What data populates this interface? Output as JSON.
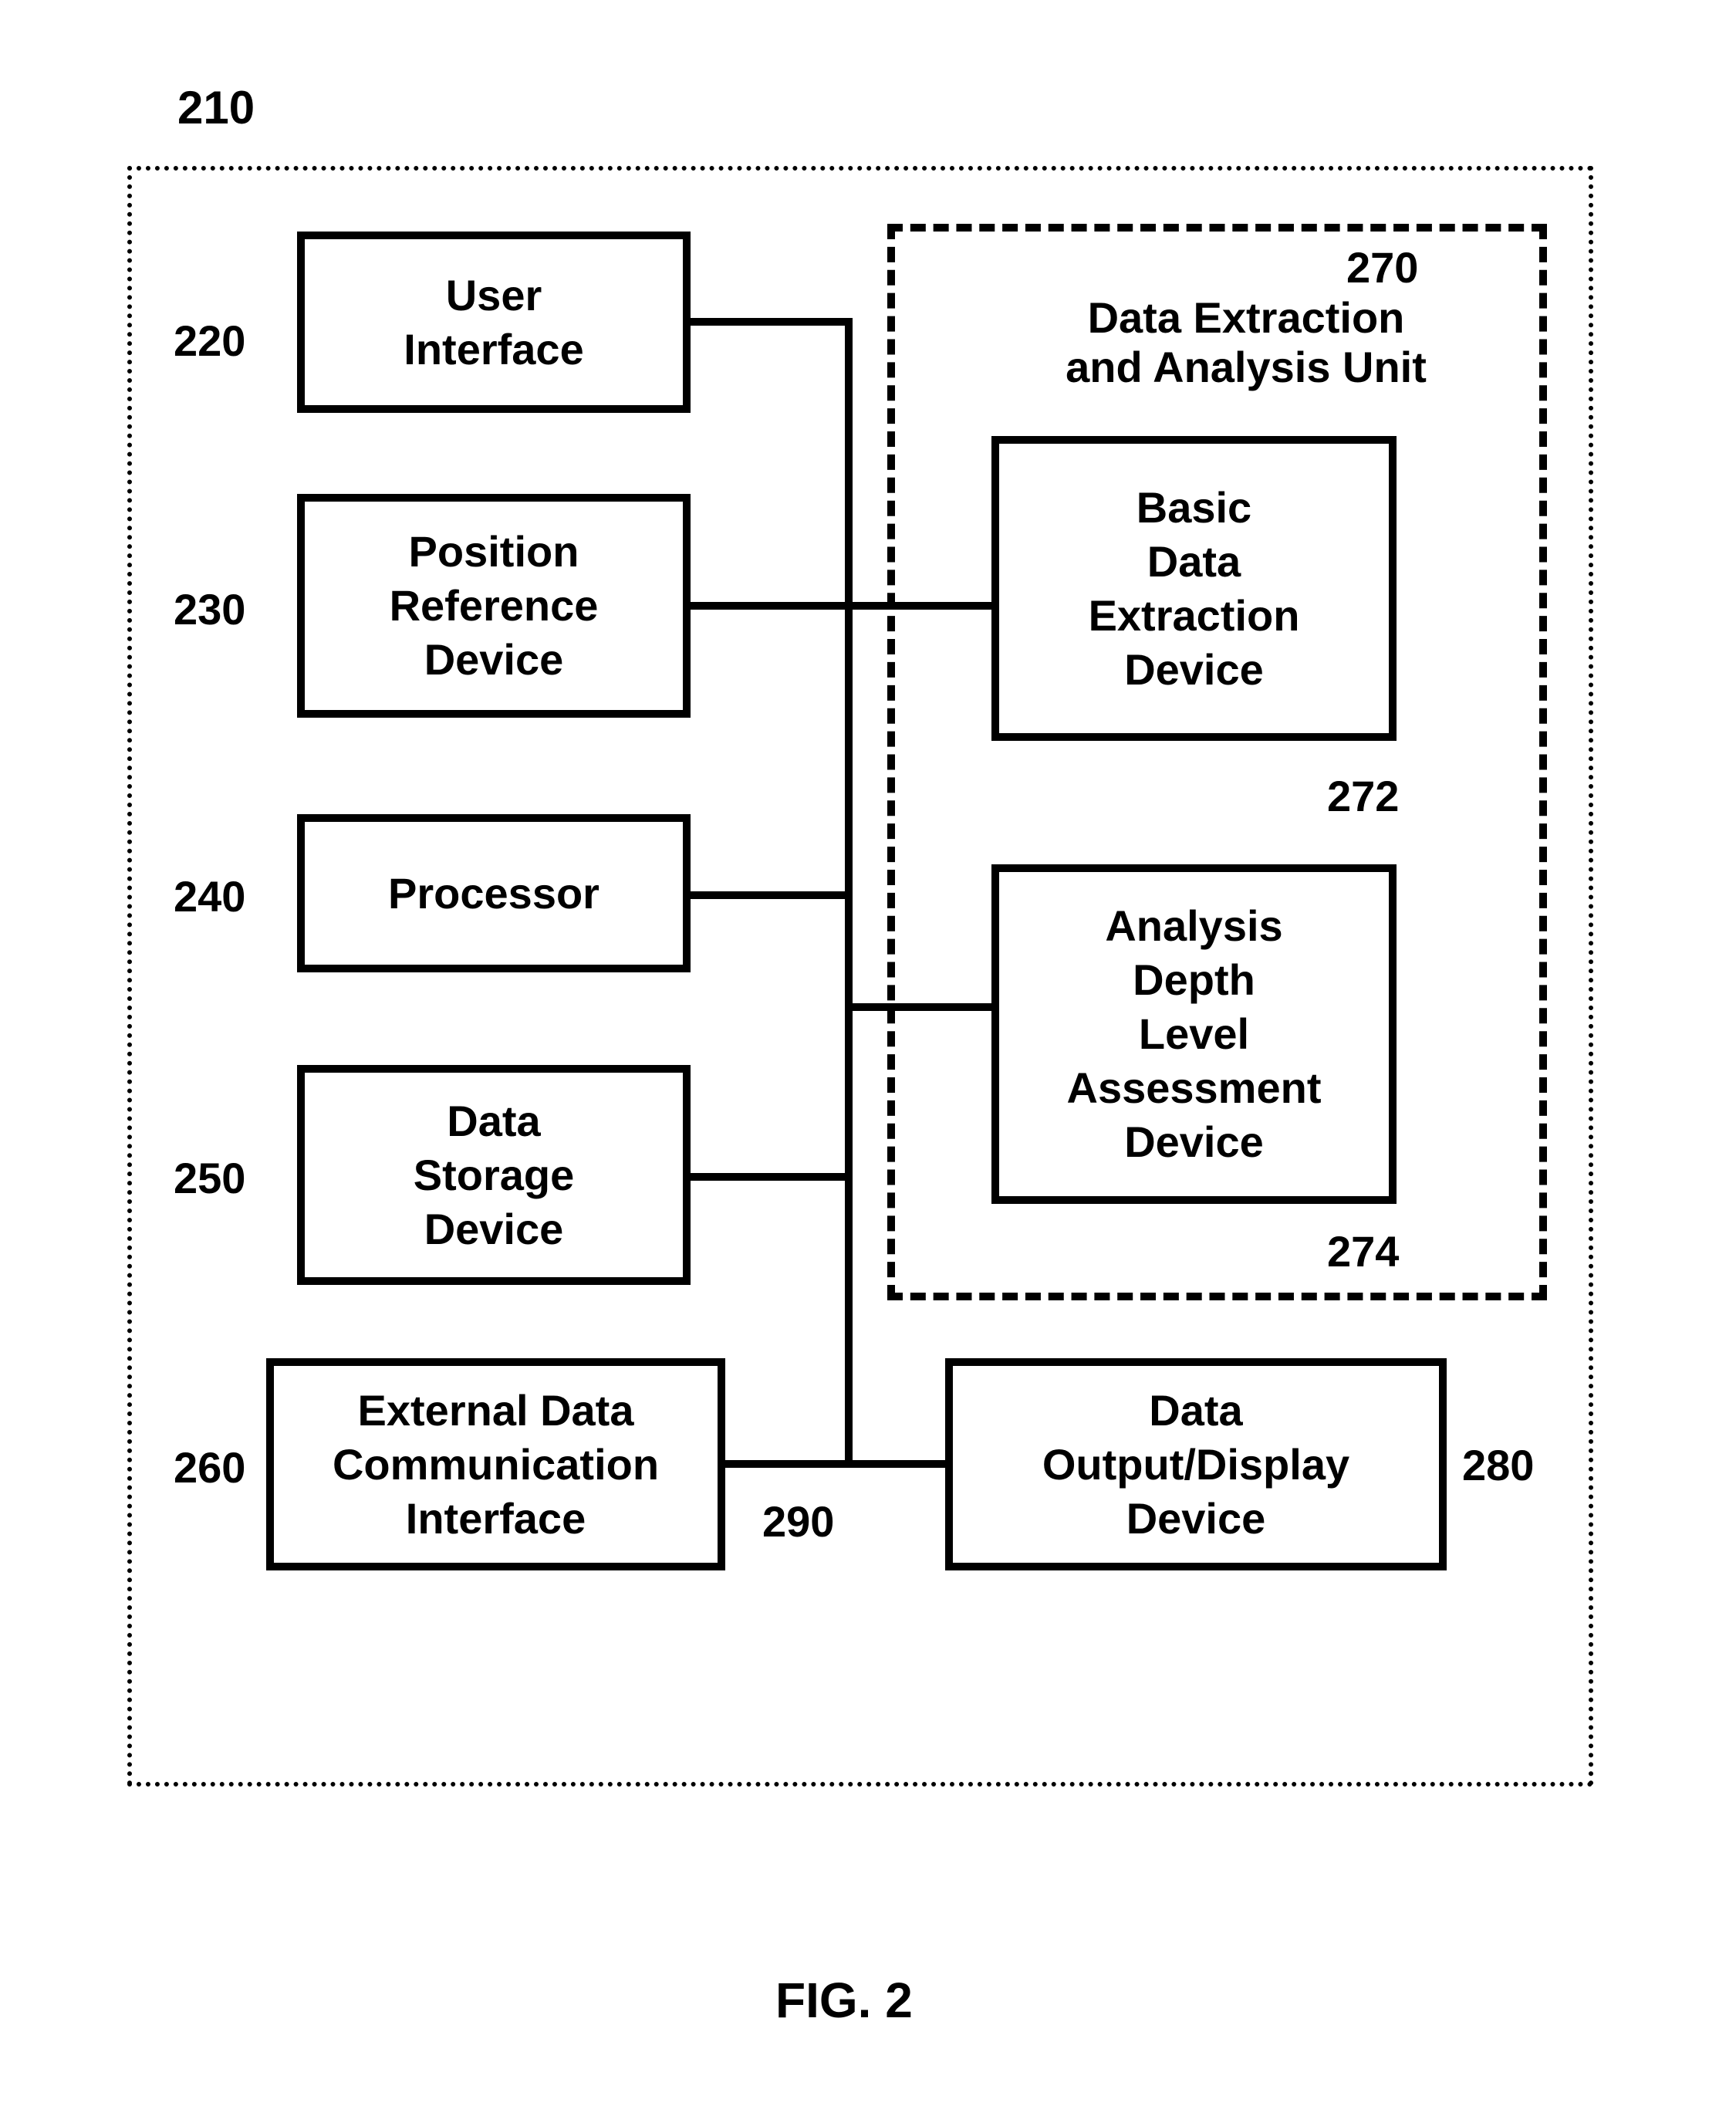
{
  "figure": {
    "caption": "FIG. 2",
    "outer_ref": "210"
  },
  "refs": {
    "r220": "220",
    "r230": "230",
    "r240": "240",
    "r250": "250",
    "r260": "260",
    "r270": "270",
    "r272": "272",
    "r274": "274",
    "r280": "280",
    "r290": "290"
  },
  "blocks": {
    "user_interface": "User\nInterface",
    "position_reference": "Position\nReference\nDevice",
    "processor": "Processor",
    "data_storage": "Data\nStorage\nDevice",
    "external_comm": "External Data\nCommunication\nInterface",
    "extraction_unit_title": "Data Extraction\nand Analysis Unit",
    "basic_extraction": "Basic\nData\nExtraction\nDevice",
    "analysis_depth": "Analysis\nDepth\nLevel\nAssessment\nDevice",
    "output_display": "Data\nOutput/Display\nDevice"
  }
}
